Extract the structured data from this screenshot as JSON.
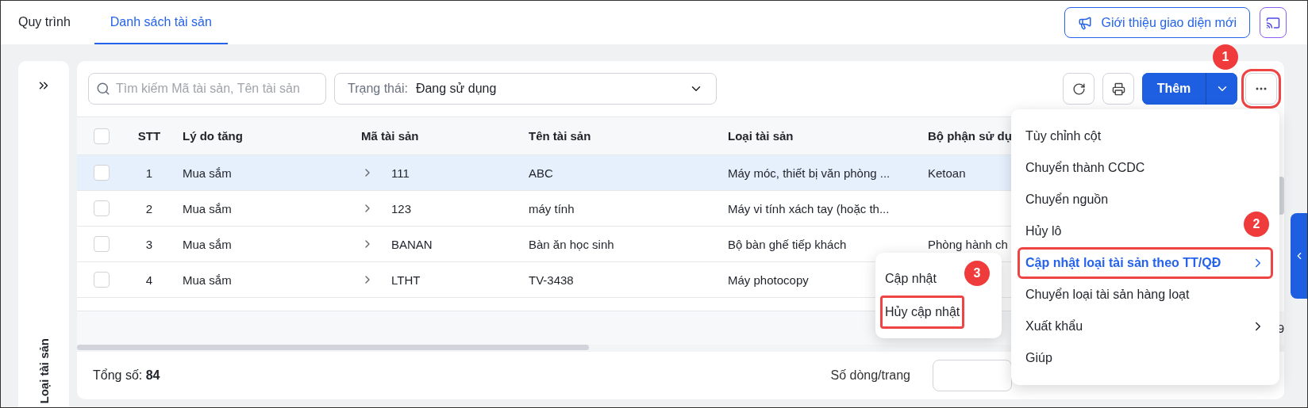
{
  "tabs": [
    {
      "label": "Quy trình",
      "selected": false
    },
    {
      "label": "Danh sách tài sản",
      "selected": true
    }
  ],
  "intro_button": {
    "label": "Giới thiệu giao diện mới"
  },
  "sidebar": {
    "title": "Loại tài sản"
  },
  "toolbar": {
    "search": {
      "placeholder": "Tìm kiếm Mã tài sản, Tên tài sản"
    },
    "status_filter": {
      "label": "Trạng thái:",
      "value": "Đang sử dụng"
    },
    "add_button": "Thêm",
    "more_button": {
      "highlighted": true,
      "badge": "1"
    }
  },
  "table": {
    "all_checked": false,
    "columns": [
      "STT",
      "Lý do tăng",
      "Mã tài sản",
      "Tên tài sản",
      "Loại tài sản",
      "Bộ phận sử dụ"
    ],
    "rows": [
      {
        "selected": true,
        "checked": false,
        "stt": "1",
        "reason": "Mua sắm",
        "code": "111",
        "name": "ABC",
        "type": "Máy móc, thiết bị văn phòng ...",
        "department": "Ketoan"
      },
      {
        "selected": false,
        "checked": false,
        "stt": "2",
        "reason": "Mua sắm",
        "code": "123",
        "name": "máy tính",
        "type": "Máy vi tính xách tay (hoặc th...",
        "department": ""
      },
      {
        "selected": false,
        "checked": false,
        "stt": "3",
        "reason": "Mua sắm",
        "code": "BANAN",
        "name": "Bàn ăn học sinh",
        "type": "Bộ bàn ghế tiếp khách",
        "department": "Phòng hành ch"
      },
      {
        "selected": false,
        "checked": false,
        "stt": "4",
        "reason": "Mua sắm",
        "code": "LTHT",
        "name": "TV-3438",
        "type": "Máy photocopy",
        "department": ""
      }
    ],
    "summary_value": "9"
  },
  "footer": {
    "total_label": "Tổng số:",
    "total": "84",
    "page_size_label": "Số dòng/trang"
  },
  "menu": {
    "items": [
      {
        "label": "Tùy chỉnh cột",
        "has_submenu": false,
        "active": false,
        "highlighted": false
      },
      {
        "label": "Chuyển thành CCDC",
        "has_submenu": false,
        "active": false,
        "highlighted": false
      },
      {
        "label": "Chuyển nguồn",
        "has_submenu": false,
        "active": false,
        "highlighted": false
      },
      {
        "label": "Hủy lô",
        "has_submenu": false,
        "active": false,
        "highlighted": false
      },
      {
        "label": "Cập nhật loại tài sản theo TT/QĐ",
        "has_submenu": true,
        "active": true,
        "highlighted": true,
        "badge": "2"
      },
      {
        "label": "Chuyển loại tài sản hàng loạt",
        "has_submenu": false,
        "active": false,
        "highlighted": false
      },
      {
        "label": "Xuất khẩu",
        "has_submenu": true,
        "active": false,
        "highlighted": false
      },
      {
        "label": "Giúp",
        "has_submenu": false,
        "active": false,
        "highlighted": false
      }
    ]
  },
  "submenu": {
    "badge": "3",
    "items": [
      {
        "label": "Cập nhật",
        "highlighted": false
      },
      {
        "label": "Hủy cập nhật",
        "highlighted": true
      }
    ]
  }
}
